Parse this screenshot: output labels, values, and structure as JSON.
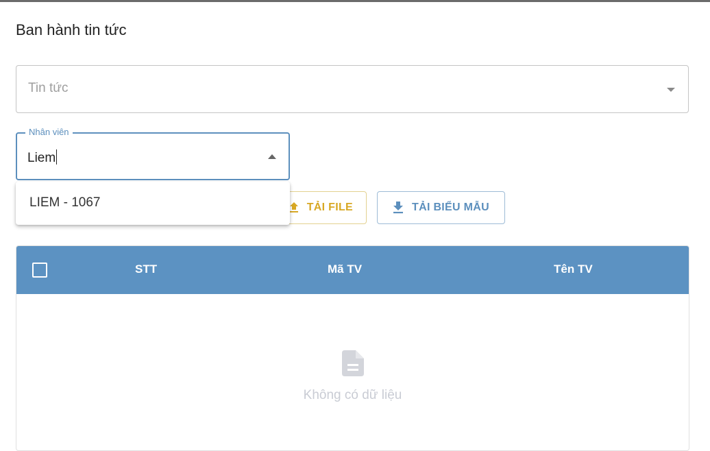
{
  "dialog": {
    "title": "Ban hành tin tức"
  },
  "news_select": {
    "placeholder": "Tin tức",
    "icon": "chevron-down-icon"
  },
  "employee_field": {
    "label": "Nhân viên",
    "value": "Liem",
    "icon": "chevron-up-icon"
  },
  "employee_dropdown": {
    "options": [
      "LIEM - 1067"
    ]
  },
  "buttons": {
    "upload_label": "TẢI FILE",
    "upload_color": "#d8a824",
    "template_label": "TẢI BIỂU MẪU",
    "template_color": "#5c8fbd"
  },
  "table": {
    "header_color": "#5c92c2",
    "columns": [
      "STT",
      "Mã TV",
      "Tên TV"
    ],
    "empty_text": "Không có dữ liệu",
    "empty_icon": "document-icon"
  }
}
